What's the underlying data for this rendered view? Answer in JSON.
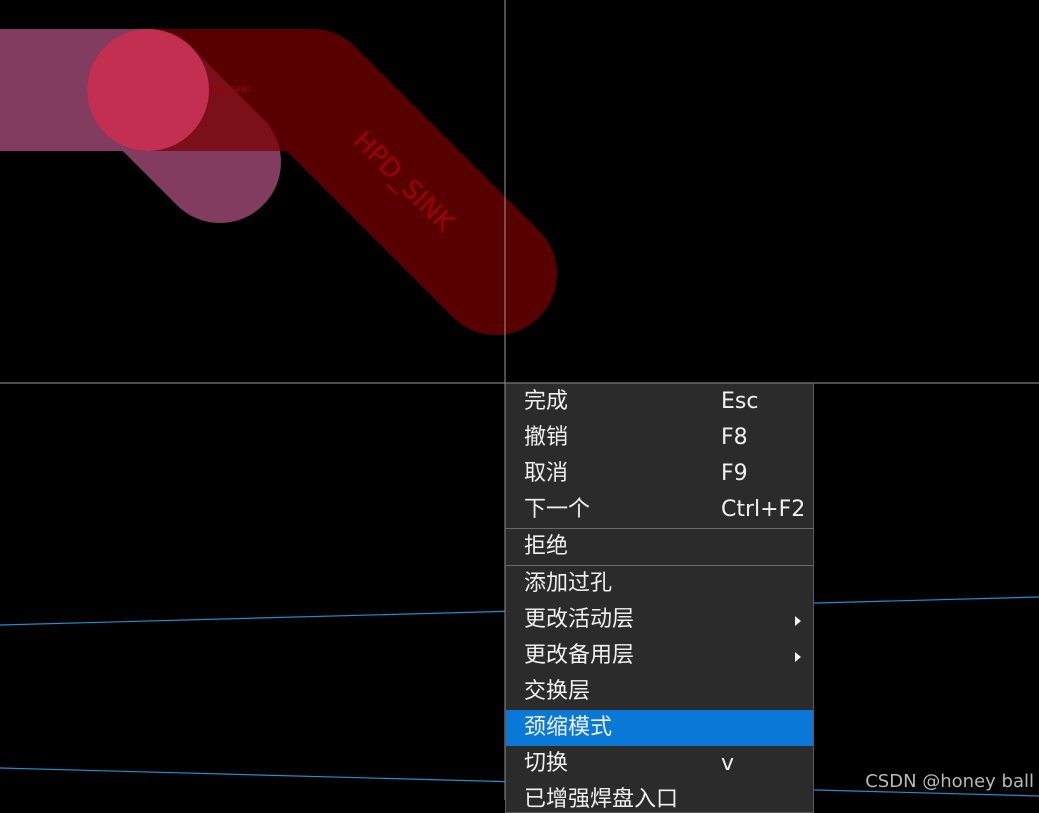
{
  "canvas": {
    "net_label": "HPD_SINK",
    "small_net_label": "HPD_SINK",
    "colors": {
      "background": "#000000",
      "top_trace": "#7a0000",
      "pink_trace": "#c65a8c",
      "pad": "#d93a64",
      "crosshair": "#9a9a9a",
      "guide_line": "#1e8fd0"
    }
  },
  "context_menu": {
    "items": [
      {
        "label": "完成",
        "shortcut": "Esc"
      },
      {
        "label": "撤销",
        "shortcut": "F8"
      },
      {
        "label": "取消",
        "shortcut": "F9"
      },
      {
        "label": "下一个",
        "shortcut": "Ctrl+F2"
      },
      {
        "label": "拒绝",
        "shortcut": ""
      },
      {
        "label": "添加过孔",
        "shortcut": ""
      },
      {
        "label": "更改活动层",
        "shortcut": ""
      },
      {
        "label": "更改备用层",
        "shortcut": ""
      },
      {
        "label": "交换层",
        "shortcut": ""
      },
      {
        "label": "颈缩模式",
        "shortcut": ""
      },
      {
        "label": "切换",
        "shortcut": "v"
      },
      {
        "label": "已增强焊盘入口",
        "shortcut": ""
      }
    ],
    "highlighted_index": 9,
    "highlight_color": "#0a78d7"
  },
  "watermark": "CSDN @honey ball"
}
